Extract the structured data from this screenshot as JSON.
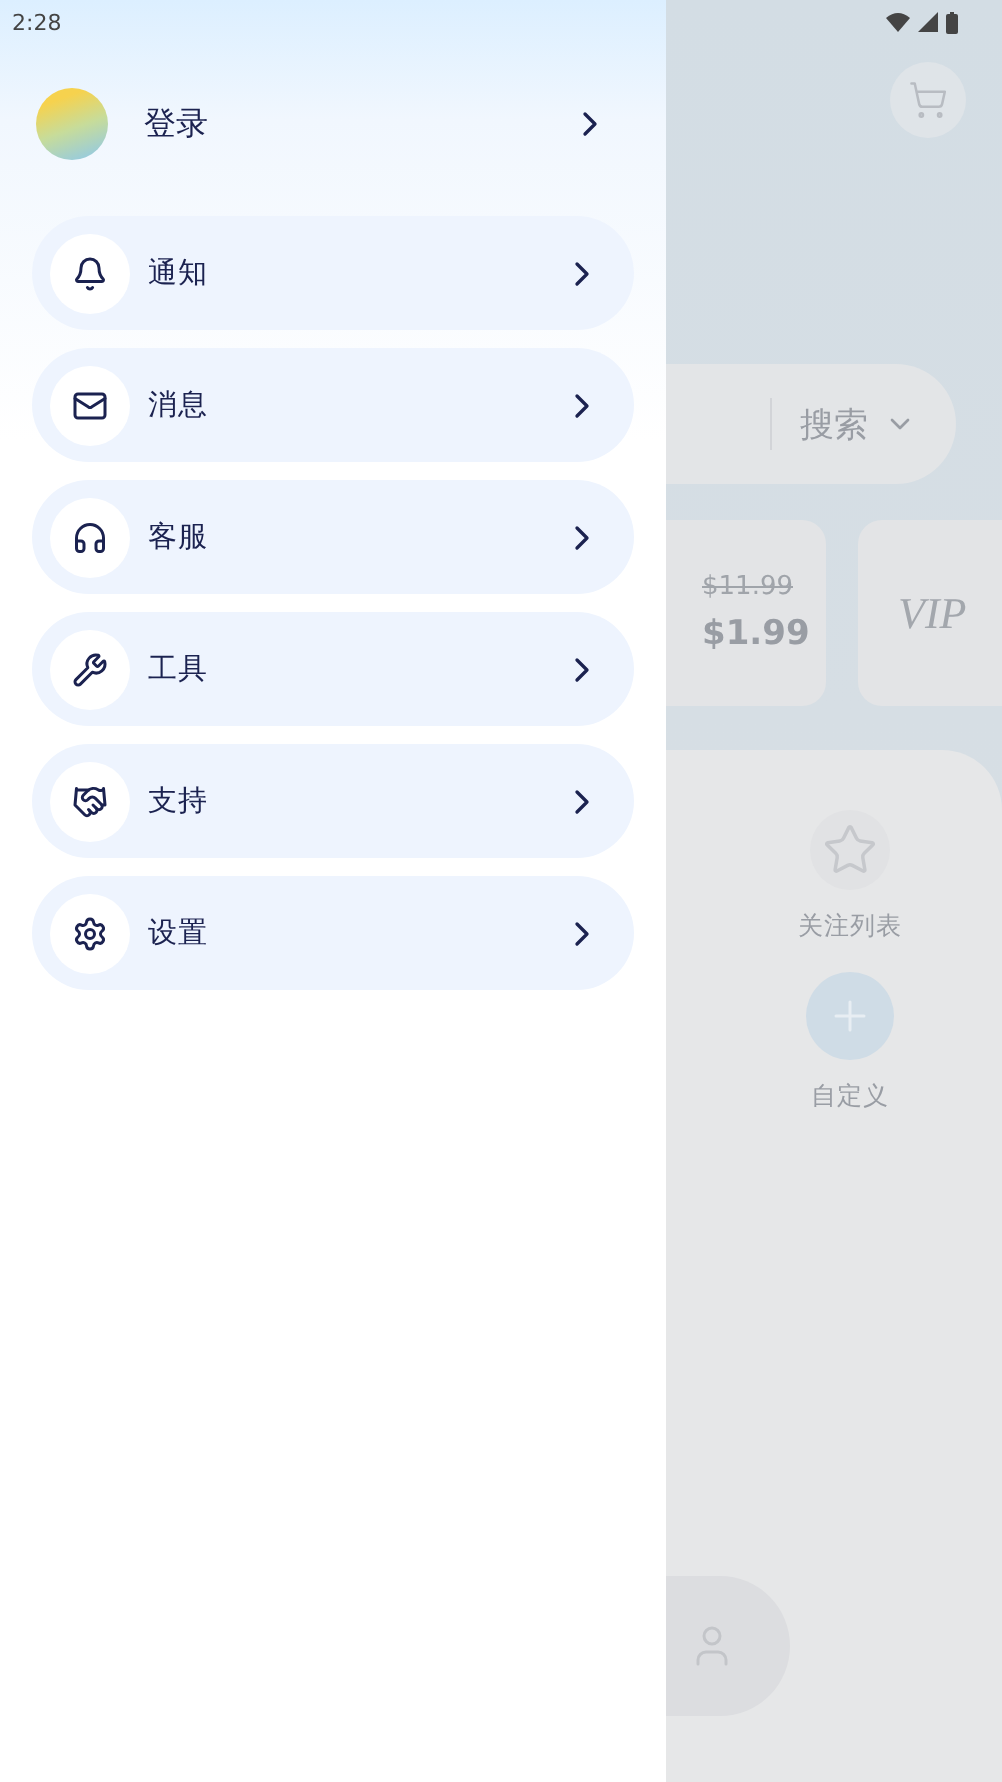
{
  "status_bar": {
    "time": "2:28"
  },
  "drawer": {
    "login": {
      "label": "登录"
    },
    "items": [
      {
        "label": "通知"
      },
      {
        "label": "消息"
      },
      {
        "label": "客服"
      },
      {
        "label": "工具"
      },
      {
        "label": "支持"
      },
      {
        "label": "设置"
      }
    ]
  },
  "background_page": {
    "search": {
      "label": "搜索"
    },
    "offers": [
      {
        "kind": "price",
        "old_price": "$11.99",
        "price": "$1.99"
      },
      {
        "kind": "vip",
        "label": "VIP"
      }
    ],
    "shortcuts": [
      {
        "kind": "star",
        "label": "关注列表"
      },
      {
        "kind": "add",
        "label": "自定义"
      }
    ]
  }
}
